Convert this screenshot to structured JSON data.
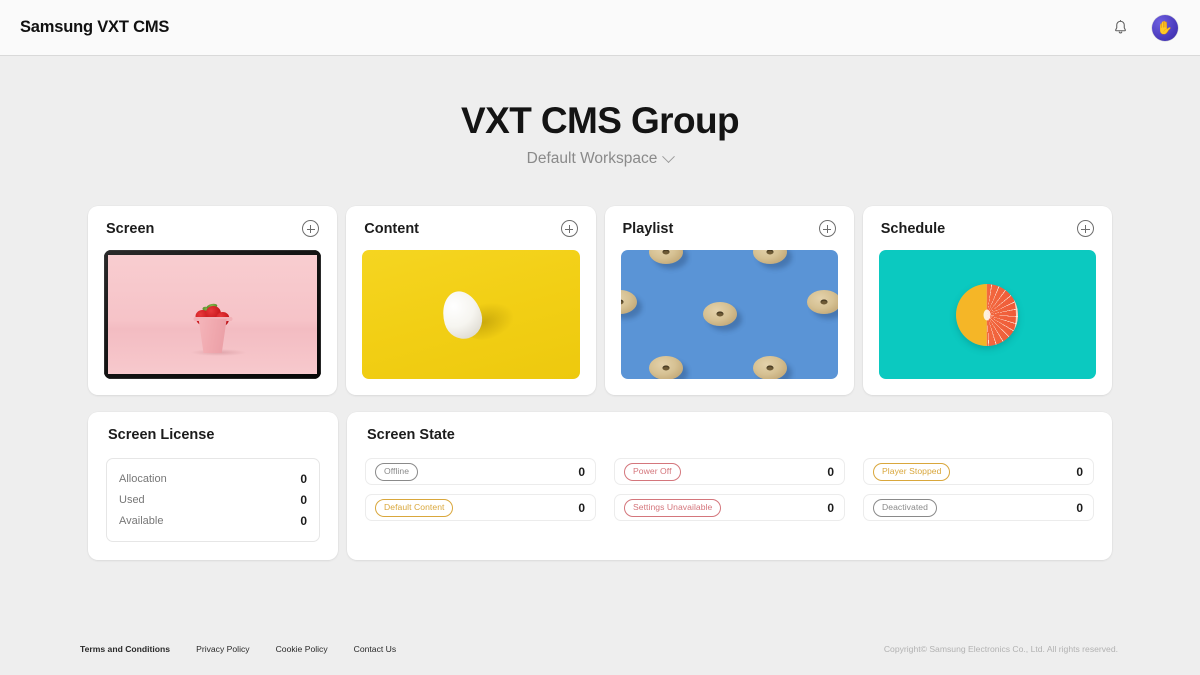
{
  "header": {
    "brand": "Samsung VXT CMS",
    "notification_icon": "bell-icon",
    "avatar_glyph": "✋"
  },
  "hero": {
    "title": "VXT CMS Group",
    "workspace": "Default Workspace",
    "workspace_chevron_icon": "chevron-down-icon"
  },
  "cards": [
    {
      "title": "Screen",
      "add_icon": "plus-circle-icon",
      "thumb": "strawberries-in-pink-pail-on-tv-screen"
    },
    {
      "title": "Content",
      "add_icon": "plus-circle-icon",
      "thumb": "white-egg-on-yellow-background"
    },
    {
      "title": "Playlist",
      "add_icon": "plus-circle-icon",
      "thumb": "donut-pattern-on-blue-background"
    },
    {
      "title": "Schedule",
      "add_icon": "plus-circle-icon",
      "thumb": "half-grapefruit-on-teal-background"
    }
  ],
  "screen_license": {
    "title": "Screen License",
    "rows": [
      {
        "label": "Allocation",
        "value": "0"
      },
      {
        "label": "Used",
        "value": "0"
      },
      {
        "label": "Available",
        "value": "0"
      }
    ]
  },
  "screen_state": {
    "title": "Screen State",
    "items": [
      {
        "label": "Offline",
        "value": "0",
        "color": "#8a8a8a"
      },
      {
        "label": "Power Off",
        "value": "0",
        "color": "#d4767c"
      },
      {
        "label": "Player Stopped",
        "value": "0",
        "color": "#d9a73c"
      },
      {
        "label": "Default Content",
        "value": "0",
        "color": "#d9a73c"
      },
      {
        "label": "Settings Unavailable",
        "value": "0",
        "color": "#d4767c"
      },
      {
        "label": "Deactivated",
        "value": "0",
        "color": "#8a8a8a"
      }
    ]
  },
  "footer": {
    "links": [
      {
        "label": "Terms and Conditions",
        "bold": true
      },
      {
        "label": "Privacy Policy",
        "bold": false
      },
      {
        "label": "Cookie Policy",
        "bold": false
      },
      {
        "label": "Contact Us",
        "bold": false
      }
    ],
    "copyright": "Copyright© Samsung Electronics Co., Ltd. All rights reserved."
  },
  "colors": {
    "page_bg": "#eeeeee",
    "header_bg": "#fafafa",
    "card_bg": "#ffffff",
    "avatar": "#4b3bbd"
  }
}
